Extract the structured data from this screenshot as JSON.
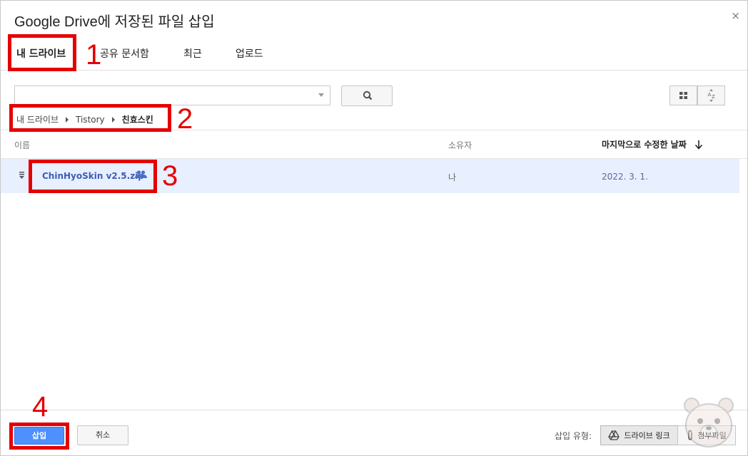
{
  "dialog": {
    "title": "Google Drive에 저장된 파일 삽입",
    "close_glyph": "×"
  },
  "tabs": [
    {
      "label": "내 드라이브",
      "active": true
    },
    {
      "label": "공유 문서함",
      "active": false
    },
    {
      "label": "최근",
      "active": false
    },
    {
      "label": "업로드",
      "active": false
    }
  ],
  "search": {
    "placeholder": "",
    "button_icon": "search-icon"
  },
  "view_buttons": [
    "grid-view-icon",
    "sort-az-icon"
  ],
  "breadcrumb": [
    "내 드라이브",
    "Tistory",
    "친효스킨"
  ],
  "table": {
    "columns": {
      "name": "이름",
      "owner": "소유자",
      "modified": "마지막으로 수정한 날짜"
    },
    "sort_icon": "arrow-down-icon",
    "rows": [
      {
        "name": "ChinHyoSkin v2.5.zip",
        "shared_icon": "people-icon",
        "owner": "나",
        "modified": "2022. 3. 1."
      }
    ]
  },
  "footer": {
    "insert_label": "삽입",
    "cancel_label": "취소",
    "insert_type_label": "삽입 유형:",
    "type_link_label": "드라이브 링크",
    "type_attach_label": "첨부파일"
  },
  "annotations": [
    "1",
    "2",
    "3",
    "4"
  ],
  "colors": {
    "annotation": "#e50000",
    "primary_button": "#4d90fe",
    "selected_row": "#e8efff",
    "link_text": "#3b5db5"
  }
}
